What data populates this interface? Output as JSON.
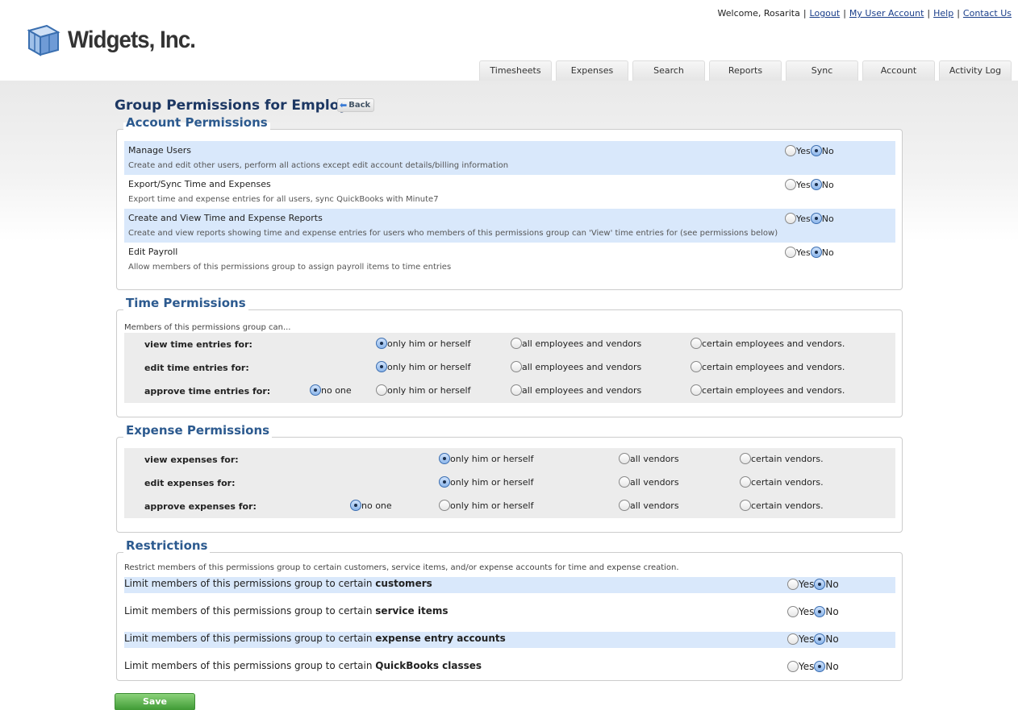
{
  "brand": {
    "name": "Widgets, Inc."
  },
  "toplinks": {
    "welcome": "Welcome, Rosarita",
    "logout": "Logout",
    "account": "My User Account",
    "help": "Help",
    "contact": "Contact Us"
  },
  "tabs": [
    "Timesheets",
    "Expenses",
    "Search",
    "Reports",
    "Sync",
    "Account",
    "Activity Log"
  ],
  "page": {
    "title": "Group Permissions for Employee",
    "back_label": "Back",
    "save_label": "Save"
  },
  "account_permissions": {
    "legend": "Account Permissions",
    "yes": "Yes",
    "no": "No",
    "rows": [
      {
        "title": "Manage Users",
        "desc": "Create and edit other users, perform all actions except edit account details/billing information",
        "value": "No"
      },
      {
        "title": "Export/Sync Time and Expenses",
        "desc": "Export time and expense entries for all users, sync QuickBooks with Minute7",
        "value": "No"
      },
      {
        "title": "Create and View Time and Expense Reports",
        "desc": "Create and view reports showing time and expense entries for users who members of this permissions group can 'View' time entries for (see permissions below)",
        "value": "No"
      },
      {
        "title": "Edit Payroll",
        "desc": "Allow members of this permissions group to assign payroll items to time entries",
        "value": "No"
      }
    ]
  },
  "time_permissions": {
    "legend": "Time Permissions",
    "intro": "Members of this permissions group can...",
    "options": {
      "none": "no one",
      "self": "only him or herself",
      "all": "all employees and vendors",
      "certain": "certain employees and vendors."
    },
    "rows": [
      {
        "label": "view time entries for:",
        "value": "self"
      },
      {
        "label": "edit time entries for:",
        "value": "self"
      },
      {
        "label": "approve time entries for:",
        "value": "none"
      }
    ]
  },
  "expense_permissions": {
    "legend": "Expense Permissions",
    "options": {
      "none": "no one",
      "self": "only him or herself",
      "all": "all vendors",
      "certain": "certain vendors."
    },
    "rows": [
      {
        "label": "view expenses for:",
        "value": "self"
      },
      {
        "label": "edit expenses for:",
        "value": "self"
      },
      {
        "label": "approve expenses for:",
        "value": "none"
      }
    ]
  },
  "restrictions": {
    "legend": "Restrictions",
    "intro": "Restrict members of this permissions group to certain customers, service items, and/or expense accounts for time and expense creation.",
    "prefix": "Limit members of this permissions group to certain",
    "yes": "Yes",
    "no": "No",
    "rows": [
      {
        "target": "customers",
        "value": "No"
      },
      {
        "target": "service items",
        "value": "No"
      },
      {
        "target": "expense entry accounts",
        "value": "No"
      },
      {
        "target": "QuickBooks classes",
        "value": "No"
      }
    ]
  },
  "colors": {
    "title": "#1c3763",
    "legend": "#2c5a8f",
    "highlight_row": "#d9e8fb",
    "save_button": "#4fa843"
  }
}
